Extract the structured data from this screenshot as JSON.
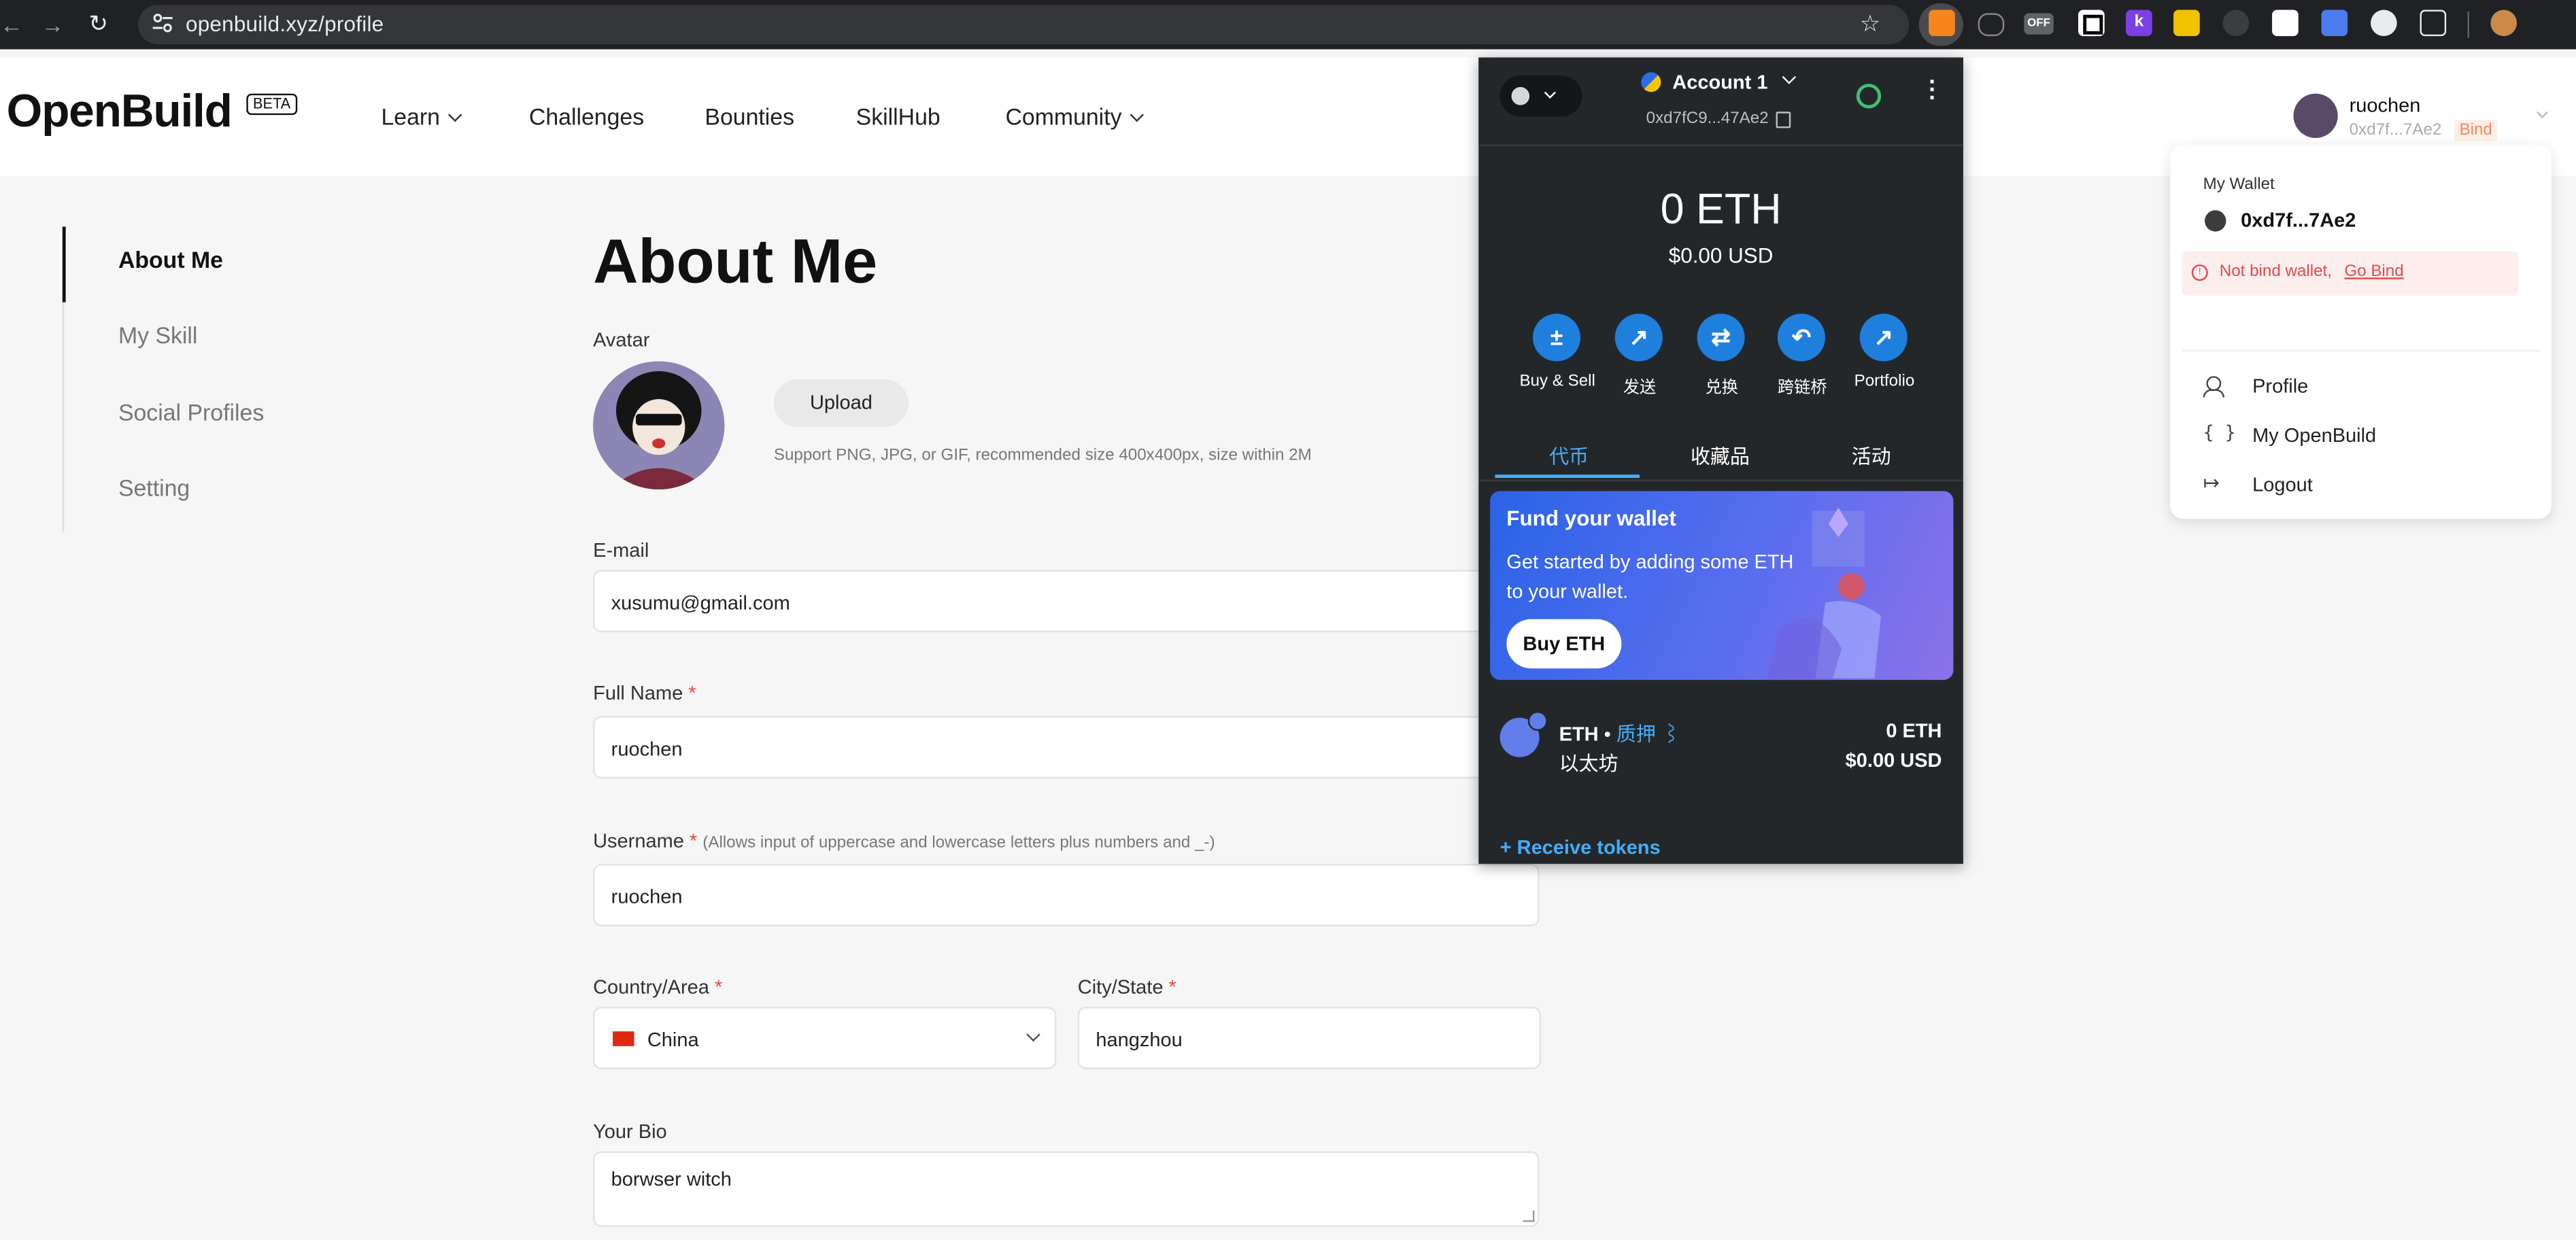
{
  "browser": {
    "url": "openbuild.xyz/profile",
    "extensions": [
      "metamask-icon",
      "spy-icon",
      "off-badge-icon",
      "square-icon",
      "k-icon",
      "chart-icon",
      "circle-icon",
      "qr-icon",
      "shield-icon",
      "camera-icon",
      "puzzle-icon"
    ],
    "ext_off_text": "OFF",
    "ext_k_text": "k"
  },
  "site": {
    "logo": "OpenBuild",
    "beta": "BETA",
    "nav": [
      {
        "label": "Learn",
        "dropdown": true
      },
      {
        "label": "Challenges",
        "dropdown": false
      },
      {
        "label": "Bounties",
        "dropdown": false
      },
      {
        "label": "SkillHub",
        "dropdown": false
      },
      {
        "label": "Community",
        "dropdown": true
      }
    ],
    "user": {
      "name": "ruochen",
      "address": "0xd7f...7Ae2",
      "bind": "Bind"
    }
  },
  "sidebar": {
    "items": [
      {
        "label": "About Me",
        "active": true
      },
      {
        "label": "My Skill",
        "active": false
      },
      {
        "label": "Social Profiles",
        "active": false
      },
      {
        "label": "Setting",
        "active": false
      }
    ]
  },
  "form": {
    "title": "About Me",
    "avatar_label": "Avatar",
    "upload_label": "Upload",
    "upload_hint": "Support PNG, JPG, or GIF, recommended size 400x400px, size within 2M",
    "email_label": "E-mail",
    "email_value": "xusumu@gmail.com",
    "fullname_label": "Full Name",
    "fullname_value": "ruochen",
    "username_label": "Username",
    "username_hint": "(Allows input of uppercase and lowercase letters plus numbers and _-)",
    "username_value": "ruochen",
    "country_label": "Country/Area",
    "country_value": "China",
    "city_label": "City/State",
    "city_value": "hangzhou",
    "bio_label": "Your Bio",
    "bio_value": "borwser witch",
    "required_mark": "*"
  },
  "metamask": {
    "account_name": "Account 1",
    "address": "0xd7fC9...47Ae2",
    "balance": "0 ETH",
    "balance_usd": "$0.00 USD",
    "actions": [
      "Buy & Sell",
      "发送",
      "兑换",
      "跨链桥",
      "Portfolio"
    ],
    "tabs": [
      "代币",
      "收藏品",
      "活动"
    ],
    "active_tab": 0,
    "fund_title": "Fund your wallet",
    "fund_text": "Get started by adding some ETH to your wallet.",
    "fund_button": "Buy ETH",
    "token_name": "ETH",
    "token_dot": "•",
    "token_stake": "质押",
    "token_subtitle": "以太坊",
    "token_amount": "0 ETH",
    "token_usd": "$0.00 USD",
    "receive": "+ Receive tokens",
    "accent": "#1f7fdc"
  },
  "account_menu": {
    "title": "My Wallet",
    "address": "0xd7f...7Ae2",
    "warning": "Not bind wallet,",
    "warning_link": "Go Bind",
    "items": [
      {
        "label": "Profile",
        "icon": "user-icon"
      },
      {
        "label": "My OpenBuild",
        "icon": "braces-icon"
      },
      {
        "label": "Logout",
        "icon": "logout-icon"
      }
    ],
    "warning_color": "#e5484d"
  }
}
